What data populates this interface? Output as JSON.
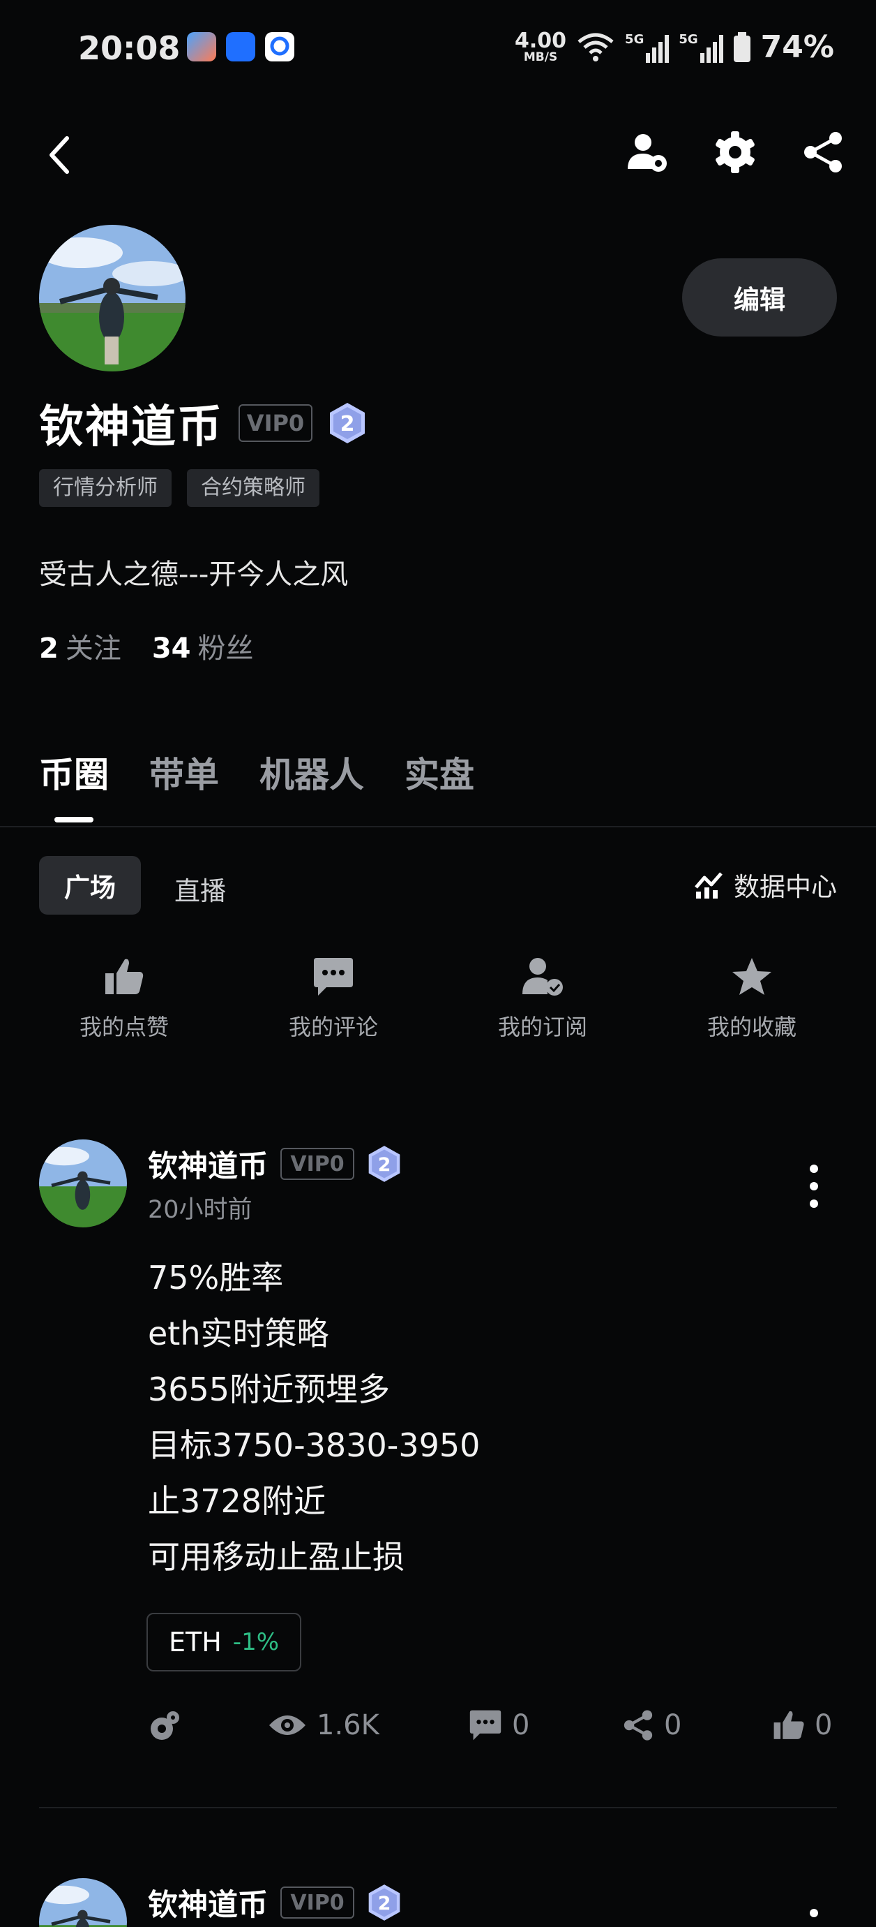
{
  "status_bar": {
    "time": "20:08",
    "net_speed_value": "4.00",
    "net_speed_unit": "MB/S",
    "signal_label_1": "5G",
    "signal_label_2": "5G",
    "battery": "74%",
    "icons": [
      "game-app-icon",
      "blue-app-icon",
      "g-app-icon",
      "wifi-icon",
      "signal-icon",
      "battery-icon"
    ]
  },
  "nav": {
    "icons": [
      "back-icon",
      "user-settings-icon",
      "gear-icon",
      "share-icon"
    ]
  },
  "profile": {
    "name": "钦神道币",
    "vip": "VIP0",
    "level": "2",
    "edit_label": "编辑",
    "tags": [
      "行情分析师",
      "合约策略师"
    ],
    "bio": "受古人之德---开今人之风",
    "following_count": "2",
    "following_label": "关注",
    "followers_count": "34",
    "followers_label": "粉丝"
  },
  "tabs": [
    {
      "label": "币圈",
      "active": true
    },
    {
      "label": "带单",
      "active": false
    },
    {
      "label": "机器人",
      "active": false
    },
    {
      "label": "实盘",
      "active": false
    }
  ],
  "sub_tabs": {
    "active": "广场",
    "other": "直播",
    "data_center": "数据中心"
  },
  "quick_actions": [
    {
      "label": "我的点赞",
      "icon": "thumb-up-icon"
    },
    {
      "label": "我的评论",
      "icon": "comment-icon"
    },
    {
      "label": "我的订阅",
      "icon": "subscribe-icon"
    },
    {
      "label": "我的收藏",
      "icon": "star-icon"
    }
  ],
  "posts": [
    {
      "author": "钦神道币",
      "vip": "VIP0",
      "level": "2",
      "time": "20小时前",
      "lines": [
        "75%胜率",
        "eth实时策略",
        "3655附近预埋多",
        "目标3750-3830-3950",
        "止3728附近",
        "可用移动止盈止损"
      ],
      "coin": {
        "symbol": "ETH",
        "change": "-1%"
      },
      "views": "1.6K",
      "comments": "0",
      "shares": "0",
      "likes": "0"
    },
    {
      "author": "钦神道币",
      "vip": "VIP0",
      "level": "2"
    }
  ],
  "colors": {
    "background": "#060708",
    "chip_bg": "#2a2c30",
    "muted_text": "#8d9096",
    "positive_green": "#2ebd85",
    "level_badge": "#b9c6ff"
  }
}
